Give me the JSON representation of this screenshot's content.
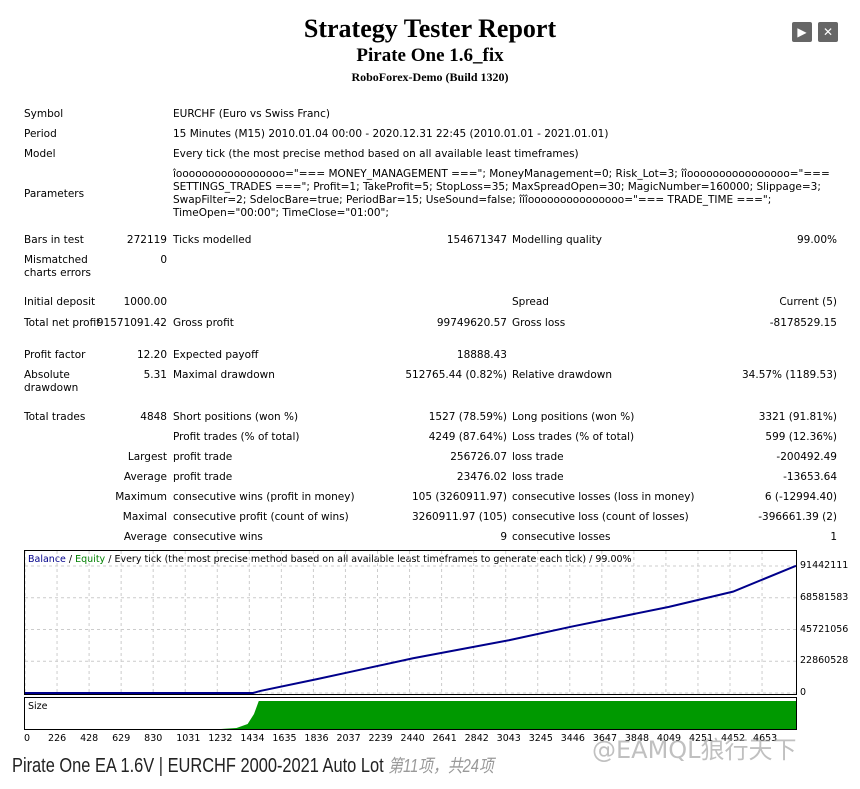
{
  "header": {
    "title": "Strategy Tester Report",
    "subtitle": "Pirate One 1.6_fix",
    "server": "RoboForex-Demo (Build 1320)"
  },
  "toolbar": {
    "play_icon": "play-icon",
    "close_icon": "close-icon"
  },
  "info": {
    "symbol_label": "Symbol",
    "symbol": "EURCHF (Euro vs Swiss Franc)",
    "period_label": "Period",
    "period": "15 Minutes (M15) 2010.01.04 00:00 - 2020.12.31 22:45 (2010.01.01 - 2021.01.01)",
    "model_label": "Model",
    "model": "Every tick (the most precise method based on all available least timeframes)",
    "parameters_label": "Parameters",
    "parameters": "îooooooooooooooooo=\"=== MONEY_MANAGEMENT ===\"; MoneyManagement=0; Risk_Lot=3; îîoooooooooooooooo=\"=== SETTINGS_TRADES ===\"; Profit=1; TakeProfit=5; StopLoss=35; MaxSpreadOpen=30; MagicNumber=160000; Slippage=3; SwapFilter=2; SdelocBare=true; PeriodBar=15; UseSound=false; îîîooooooooooooooo=\"=== TRADE_TIME ===\"; TimeOpen=\"00:00\"; TimeClose=\"01:00\";"
  },
  "stats": [
    {
      "l1": "Bars in test",
      "v1": "272119",
      "l2": "Ticks modelled",
      "v2": "154671347",
      "l3": "Modelling quality",
      "v3": "99.00%"
    },
    {
      "l1": "Mismatched charts errors",
      "v1": "0",
      "l2": "",
      "v2": "",
      "l3": "",
      "v3": ""
    },
    {
      "l1": "Initial deposit",
      "v1": "1000.00",
      "l2": "",
      "v2": "",
      "l3": "Spread",
      "v3": "Current (5)"
    },
    {
      "l1": "Total net profit",
      "v1": "91571091.42",
      "l2": "Gross profit",
      "v2": "99749620.57",
      "l3": "Gross loss",
      "v3": "-8178529.15"
    },
    {
      "l1": "Profit factor",
      "v1": "12.20",
      "l2": "Expected payoff",
      "v2": "18888.43",
      "l3": "",
      "v3": ""
    },
    {
      "l1": "Absolute drawdown",
      "v1": "5.31",
      "l2": "Maximal drawdown",
      "v2": "512765.44 (0.82%)",
      "l3": "Relative drawdown",
      "v3": "34.57% (1189.53)"
    },
    {
      "l1": "Total trades",
      "v1": "4848",
      "l2": "Short positions (won %)",
      "v2": "1527 (78.59%)",
      "l3": "Long positions (won %)",
      "v3": "3321 (91.81%)"
    },
    {
      "l1": "",
      "v1": "",
      "l2": "Profit trades (% of total)",
      "v2": "4249 (87.64%)",
      "l3": "Loss trades (% of total)",
      "v3": "599 (12.36%)"
    },
    {
      "l1": "",
      "v1": "Largest",
      "l2": "profit trade",
      "v2": "256726.07",
      "l3": "loss trade",
      "v3": "-200492.49"
    },
    {
      "l1": "",
      "v1": "Average",
      "l2": "profit trade",
      "v2": "23476.02",
      "l3": "loss trade",
      "v3": "-13653.64"
    },
    {
      "l1": "",
      "v1": "Maximum",
      "l2": "consecutive wins (profit in money)",
      "v2": "105 (3260911.97)",
      "l3": "consecutive losses (loss in money)",
      "v3": "6 (-12994.40)"
    },
    {
      "l1": "",
      "v1": "Maximal",
      "l2": "consecutive profit (count of wins)",
      "v2": "3260911.97 (105)",
      "l3": "consecutive loss (count of losses)",
      "v3": "-396661.39 (2)"
    },
    {
      "l1": "",
      "v1": "Average",
      "l2": "consecutive wins",
      "v2": "9",
      "l3": "consecutive losses",
      "v3": "1"
    }
  ],
  "chart_data": {
    "type": "line",
    "legend": {
      "balance": "Balance",
      "equity": "Equity",
      "rest": "/ Every tick (the most precise method based on all available least timeframes to generate each tick) / 99.00%"
    },
    "colors": {
      "balance": "#00008b",
      "equity": "#008000",
      "size": "#009900"
    },
    "x": [
      0,
      1434,
      1480,
      1836,
      2037,
      2440,
      3043,
      3446,
      4049,
      4452,
      4848
    ],
    "series": [
      {
        "name": "Balance",
        "values": [
          1000,
          1000,
          1500000,
          10000000,
          15000000,
          25000000,
          38000000,
          48000000,
          62000000,
          73000000,
          91571091
        ]
      }
    ],
    "yticks": [
      "91442111",
      "68581583",
      "45721056",
      "22860528",
      "0"
    ],
    "ylim": [
      0,
      91442111
    ],
    "xticks": [
      "0",
      "226",
      "428",
      "629",
      "830",
      "1031",
      "1232",
      "1434",
      "1635",
      "1836",
      "2037",
      "2239",
      "2440",
      "2641",
      "2842",
      "3043",
      "3245",
      "3446",
      "3647",
      "3848",
      "4049",
      "4251",
      "4452",
      "4653"
    ],
    "xlim": [
      0,
      4848
    ],
    "size_label": "Size",
    "grid": true
  },
  "caption": {
    "text": "Pirate One EA 1.6V | EURCHF 2000-2021 Auto Lot",
    "page": "第11项，共24项"
  },
  "watermark": "@EAMQL狼行天下"
}
